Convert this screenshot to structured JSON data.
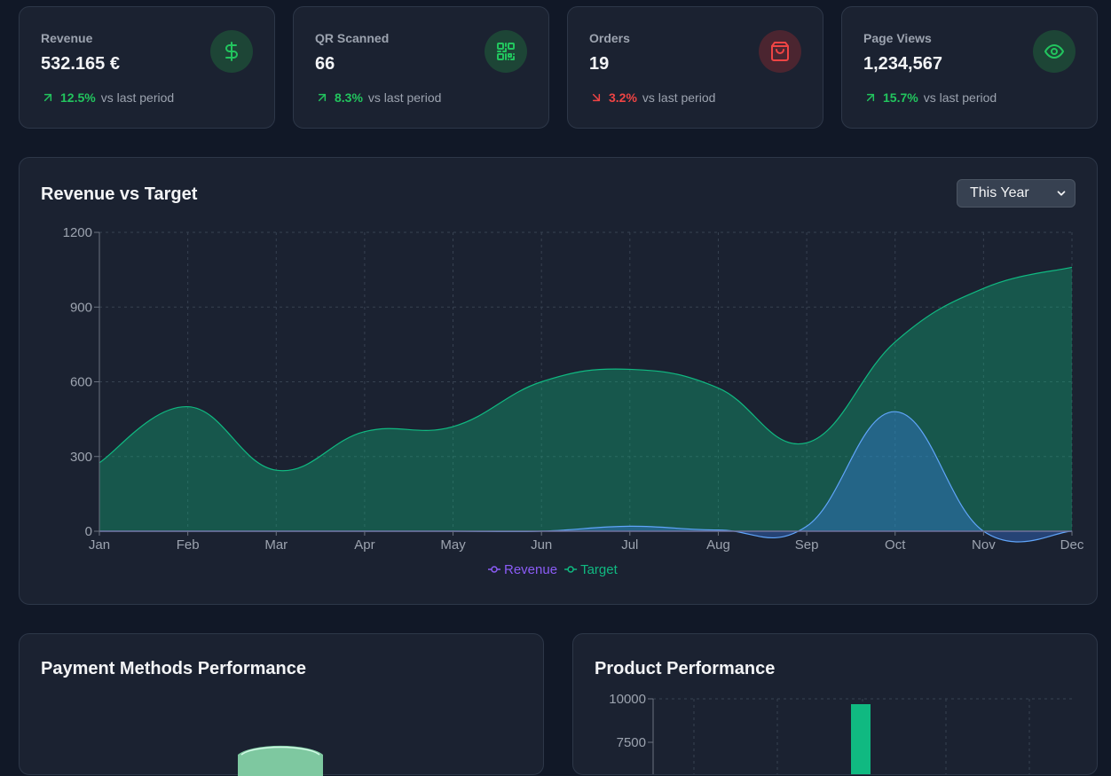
{
  "stats": [
    {
      "label": "Revenue",
      "value": "532.165 €",
      "trend": "12.5%",
      "direction": "up",
      "suffix": "vs last period",
      "icon": "dollar-icon",
      "tone": "green"
    },
    {
      "label": "QR Scanned",
      "value": "66",
      "trend": "8.3%",
      "direction": "up",
      "suffix": "vs last period",
      "icon": "qr-code-icon",
      "tone": "green"
    },
    {
      "label": "Orders",
      "value": "19",
      "trend": "3.2%",
      "direction": "down",
      "suffix": "vs last period",
      "icon": "shopping-bag-icon",
      "tone": "red"
    },
    {
      "label": "Page Views",
      "value": "1,234,567",
      "trend": "15.7%",
      "direction": "up",
      "suffix": "vs last period",
      "icon": "eye-icon",
      "tone": "green"
    }
  ],
  "colors": {
    "up": "#22c55e",
    "down": "#ef4444",
    "revenue": "#8b5cf6",
    "target": "#10b981",
    "revenue_fill": "#3b82f6"
  },
  "revenue_chart": {
    "title": "Revenue vs Target",
    "period": "This Year",
    "legend": [
      "Revenue",
      "Target"
    ]
  },
  "payment_methods": {
    "title": "Payment Methods Performance"
  },
  "product_performance": {
    "title": "Product Performance"
  },
  "chart_data": [
    {
      "type": "area",
      "title": "Revenue vs Target",
      "categories": [
        "Jan",
        "Feb",
        "Mar",
        "Apr",
        "May",
        "Jun",
        "Jul",
        "Aug",
        "Sep",
        "Oct",
        "Nov",
        "Dec"
      ],
      "ylim": [
        0,
        1200
      ],
      "yticks": [
        0,
        300,
        600,
        900,
        1200
      ],
      "grid": true,
      "legend": "bottom-center",
      "series": [
        {
          "name": "Revenue",
          "values": [
            0,
            0,
            0,
            0,
            0,
            0,
            20,
            5,
            20,
            480,
            0,
            0
          ]
        },
        {
          "name": "Target",
          "values": [
            275,
            500,
            245,
            400,
            420,
            600,
            650,
            575,
            355,
            760,
            975,
            1060
          ]
        }
      ]
    },
    {
      "type": "bar",
      "title": "Product Performance",
      "yticks": [
        7500,
        10000
      ],
      "values": [
        10000
      ],
      "grid": true
    }
  ]
}
